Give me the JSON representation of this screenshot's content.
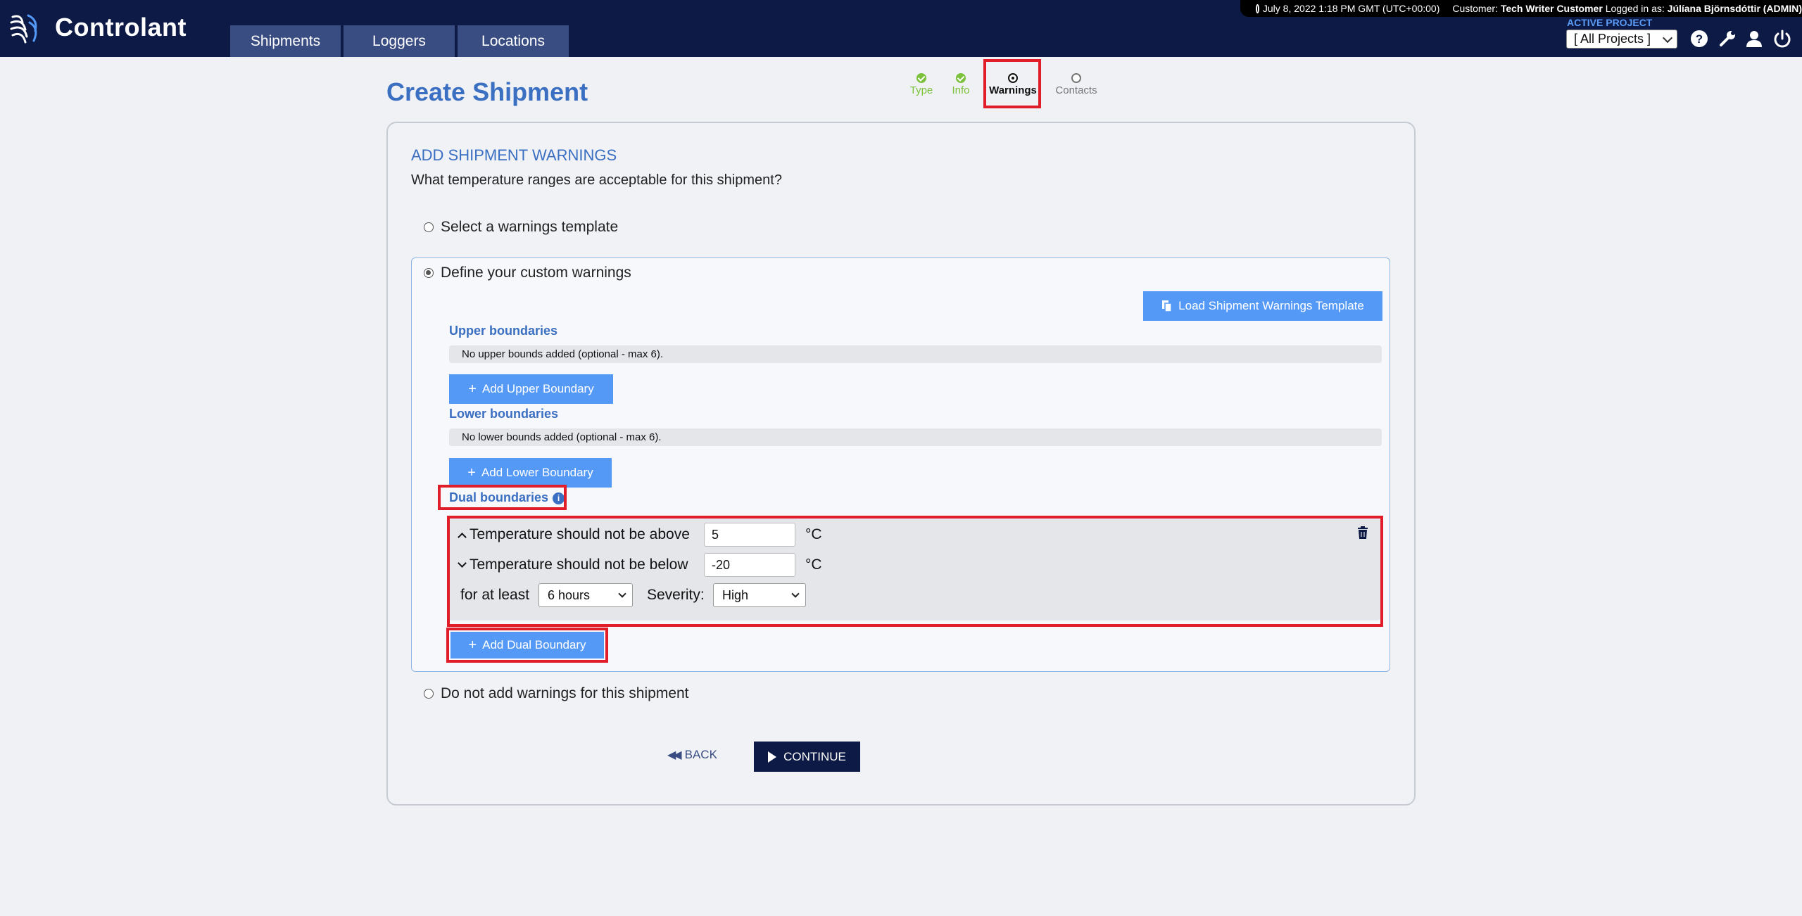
{
  "header": {
    "brand": "Controlant",
    "tabs": [
      "Shipments",
      "Loggers",
      "Locations"
    ],
    "datetime": "July 8, 2022 1:18 PM GMT (UTC+00:00)",
    "customer_label": "Customer:",
    "customer_name": "Tech Writer Customer",
    "logged_label": "Logged in as:",
    "user_name": "Júlíana Björnsdóttir (ADMIN)",
    "active_project_label": "ACTIVE PROJECT",
    "project_value": "[ All Projects ]"
  },
  "page": {
    "title": "Create Shipment",
    "steps": [
      {
        "label": "Type",
        "state": "done"
      },
      {
        "label": "Info",
        "state": "done"
      },
      {
        "label": "Warnings",
        "state": "current"
      },
      {
        "label": "Contacts",
        "state": "todo"
      }
    ]
  },
  "form": {
    "section_title": "ADD SHIPMENT WARNINGS",
    "section_subtitle": "What temperature ranges are acceptable for this shipment?",
    "option_template": "Select a warnings template",
    "option_custom": "Define your custom warnings",
    "option_none": "Do not add warnings for this shipment",
    "load_template_button": "Load Shipment Warnings Template",
    "upper": {
      "heading": "Upper boundaries",
      "empty_text": "No upper bounds added (optional - max 6).",
      "add_button": "Add Upper Boundary"
    },
    "lower": {
      "heading": "Lower boundaries",
      "empty_text": "No lower bounds added (optional - max 6).",
      "add_button": "Add Lower Boundary"
    },
    "dual": {
      "heading": "Dual boundaries",
      "above_label": "Temperature should not be above",
      "above_value": "5",
      "below_label": "Temperature should not be below",
      "below_value": "-20",
      "unit": "°C",
      "duration_label": "for at least",
      "duration_value": "6 hours",
      "severity_label": "Severity:",
      "severity_value": "High",
      "add_button": "Add Dual Boundary"
    },
    "back_button": "BACK",
    "continue_button": "CONTINUE"
  },
  "colors": {
    "header_bg": "#0d1a45",
    "accent_blue": "#5599f7",
    "title_blue": "#3a6fc2",
    "highlight_red": "#e11d2a",
    "step_done": "#7cc13b"
  }
}
